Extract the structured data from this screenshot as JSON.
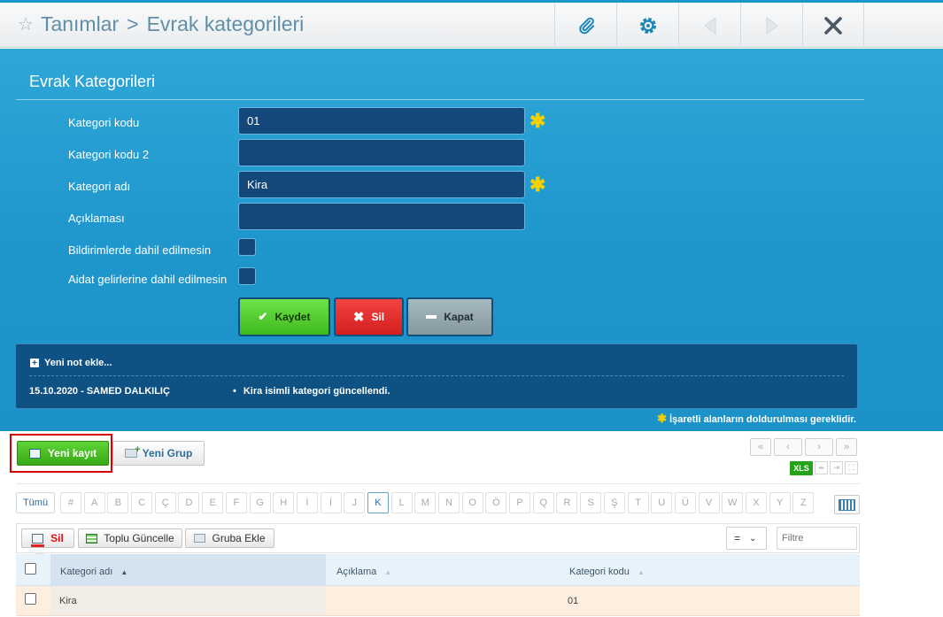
{
  "header": {
    "breadcrumb_root": "Tanımlar",
    "breadcrumb_sep": ">",
    "breadcrumb_page": "Evrak kategorileri"
  },
  "form": {
    "title": "Evrak Kategorileri",
    "fields": {
      "kategori_kodu": {
        "label": "Kategori kodu",
        "value": "01"
      },
      "kategori_kodu2": {
        "label": "Kategori kodu 2",
        "value": ""
      },
      "kategori_adi": {
        "label": "Kategori adı",
        "value": "Kira"
      },
      "aciklama": {
        "label": "Açıklaması",
        "value": ""
      },
      "bildirim": {
        "label": "Bildirimlerde dahil edilmesin"
      },
      "aidat": {
        "label": "Aidat gelirlerine dahil edilmesin"
      }
    },
    "buttons": {
      "save": "Kaydet",
      "delete": "Sil",
      "close": "Kapat"
    }
  },
  "notes": {
    "add_label": "Yeni not ekle...",
    "entries": [
      {
        "date_user": "15.10.2020 - SAMED DALKILIÇ",
        "text": "Kira isimli kategori güncellendi."
      }
    ],
    "required_note": "İşaretli alanların doldurulması gereklidir."
  },
  "list": {
    "new_record": "Yeni kayıt",
    "new_group": "Yeni Grup",
    "pager": [
      "«",
      "‹",
      "›",
      "»"
    ],
    "export": "XLS",
    "letters": [
      "Tümü",
      "#",
      "A",
      "B",
      "C",
      "Ç",
      "D",
      "E",
      "F",
      "G",
      "H",
      "I",
      "İ",
      "J",
      "K",
      "L",
      "M",
      "N",
      "O",
      "Ö",
      "P",
      "Q",
      "R",
      "S",
      "Ş",
      "T",
      "U",
      "Ü",
      "V",
      "W",
      "X",
      "Y",
      "Z"
    ],
    "active_letter": "K",
    "toolbar": {
      "delete": "Sil",
      "bulk_update": "Toplu Güncelle",
      "add_to_group": "Gruba Ekle",
      "operator": "=",
      "filter_placeholder": "Filtre"
    },
    "columns": [
      "Kategori adı",
      "Açıklama",
      "Kategori kodu"
    ],
    "rows": [
      {
        "kategori_adi": "Kira",
        "aciklama": "",
        "kategori_kodu": "01"
      }
    ]
  },
  "colors": {
    "accent": "#1b96c9",
    "save": "#4fc72e",
    "delete": "#e52c2c",
    "close": "#8fa3ad",
    "highlight": "#d90000"
  }
}
